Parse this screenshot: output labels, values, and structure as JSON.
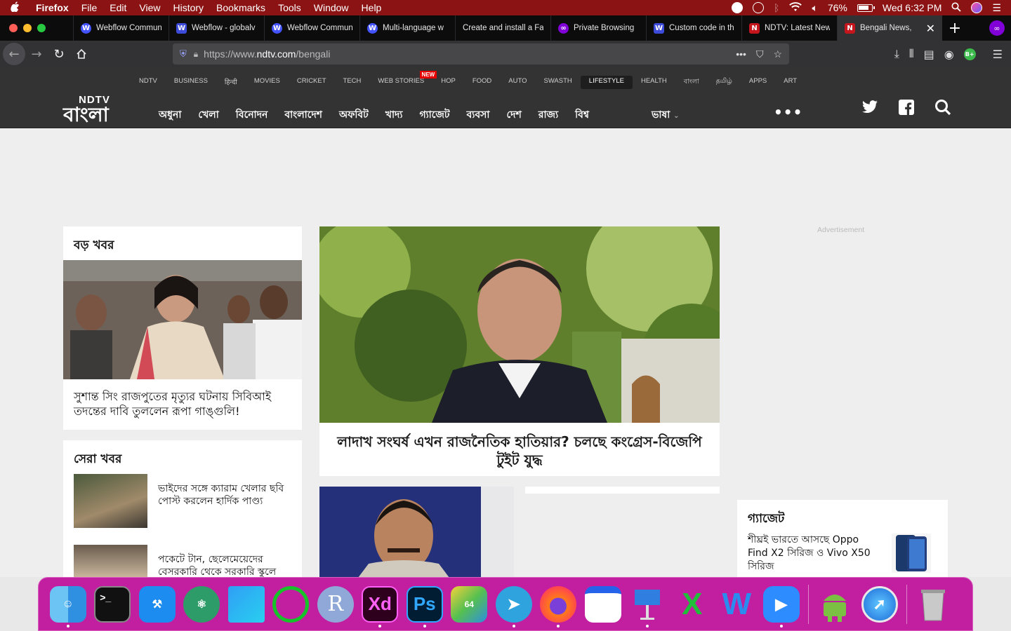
{
  "menubar": {
    "app": "Firefox",
    "items": [
      "File",
      "Edit",
      "View",
      "History",
      "Bookmarks",
      "Tools",
      "Window",
      "Help"
    ],
    "battery": "76%",
    "clock": "Wed 6:32 PM"
  },
  "tabs": [
    {
      "label": "Webflow Commun",
      "favicon": "webflow-icon"
    },
    {
      "label": "Webflow - globalv",
      "favicon": "w-icon"
    },
    {
      "label": "Webflow Commun",
      "favicon": "webflow-icon"
    },
    {
      "label": "Multi-language w",
      "favicon": "webflow-icon"
    },
    {
      "label": "Create and install a Fa",
      "favicon": "none"
    },
    {
      "label": "Private Browsing",
      "favicon": "private-mask-icon"
    },
    {
      "label": "Custom code in th",
      "favicon": "w-icon"
    },
    {
      "label": "NDTV: Latest New",
      "favicon": "ndtv-icon"
    },
    {
      "label": "Bengali News,",
      "favicon": "ndtv-icon",
      "active": true
    }
  ],
  "urlbar": {
    "url_prefix": "https://www.",
    "url_host": "ndtv.com",
    "url_path": "/bengali"
  },
  "site": {
    "top_nav": [
      "NDTV",
      "BUSINESS",
      "हिन्दी",
      "MOVIES",
      "CRICKET",
      "TECH",
      "WEB STORIES",
      "HOP",
      "FOOD",
      "AUTO",
      "SWASTH",
      "LIFESTYLE",
      "HEALTH",
      "বাংলা",
      "தமிழ்",
      "APPS",
      "ART"
    ],
    "new_badge": "NEW",
    "logo_top": "NDTV",
    "logo_bottom": "বাংলা",
    "main_nav": [
      "অধুনা",
      "খেলা",
      "বিনোদন",
      "বাংলাদেশ",
      "অফবিট",
      "খাদ্য",
      "গ্যাজেট",
      "ব্যবসা",
      "দেশ",
      "রাজ্য",
      "বিশ্ব"
    ],
    "language": "ভাষা",
    "more": "•••"
  },
  "content": {
    "top_news_heading": "বড় খবর",
    "top_news_headline": "সুশান্ত সিং রাজপুতের মৃত্যুর ঘটনায় সিবিআই তদন্তের দাবি তুললেন রূপা গাঙ্গুলি!",
    "lead_headline": "লাদাখ সংঘর্ষ এখন রাজনৈতিক হাতিয়ার? চলছে কংগ্রেস-বিজেপি টুইট যুদ্ধ",
    "best_news_heading": "সেরা খবর",
    "best_news": [
      {
        "headline": "ভাইদের সঙ্গে ক্যারাম খেলার ছবি পোস্ট করলেন হার্দিক পাণ্ড্য"
      },
      {
        "headline": "পকেটে টান, ছেলেমেয়েদের বেসরকারি থেকে সরকারি স্কুলে"
      }
    ],
    "advertisement": "Advertisement",
    "gadget_heading": "গ্যাজেট",
    "gadget_headline": "শীঘ্রই ভারতে আসছে Oppo Find X2 সিরিজ ও Vivo X50 সিরিজ"
  },
  "dock": [
    "finder-icon",
    "terminal-icon",
    "xcode-icon",
    "atom-icon",
    "sketch-app-icon",
    "circle-app-icon",
    "r-app-icon",
    "adobe-xd-icon",
    "photoshop-icon",
    "bluestacks-icon",
    "telegram-icon",
    "firefox-icon",
    "notes-icon",
    "keynote-icon",
    "excel-x-icon",
    "w-app-icon",
    "zoom-icon",
    "android-icon",
    "safari-icon",
    "trash-icon"
  ]
}
